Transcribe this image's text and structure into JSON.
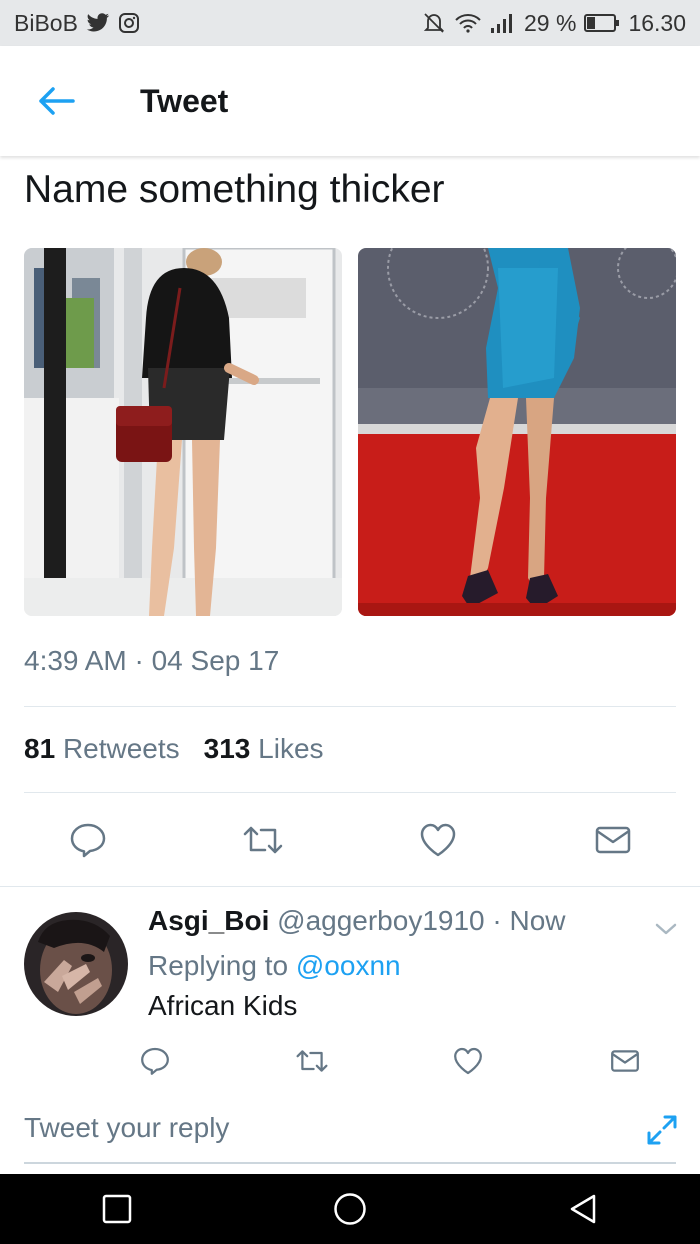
{
  "status_bar": {
    "carrier": "BiBoB",
    "battery_percent": "29 %",
    "time": "16.30",
    "icons": [
      "twitter-bird-icon",
      "instagram-icon",
      "mute-icon",
      "wifi-icon",
      "signal-icon",
      "battery-icon"
    ]
  },
  "header": {
    "title": "Tweet"
  },
  "tweet": {
    "text": "Name something thicker",
    "timestamp": "4:39 AM · 04 Sep 17",
    "retweets_count": "81",
    "retweets_label": "Retweets",
    "likes_count": "313",
    "likes_label": "Likes"
  },
  "reply": {
    "name": "Asgi_Boi",
    "handle": "@aggerboy1910",
    "time": "· Now",
    "replying_to_label": "Replying to",
    "replying_to_handle": "@ooxnn",
    "text": "African Kids"
  },
  "compose": {
    "placeholder": "Tweet your reply"
  },
  "colors": {
    "accent": "#1da1f2",
    "secondary_text": "#657786",
    "divider": "#e1e8ed",
    "status_bar": "#e6e8ea"
  }
}
